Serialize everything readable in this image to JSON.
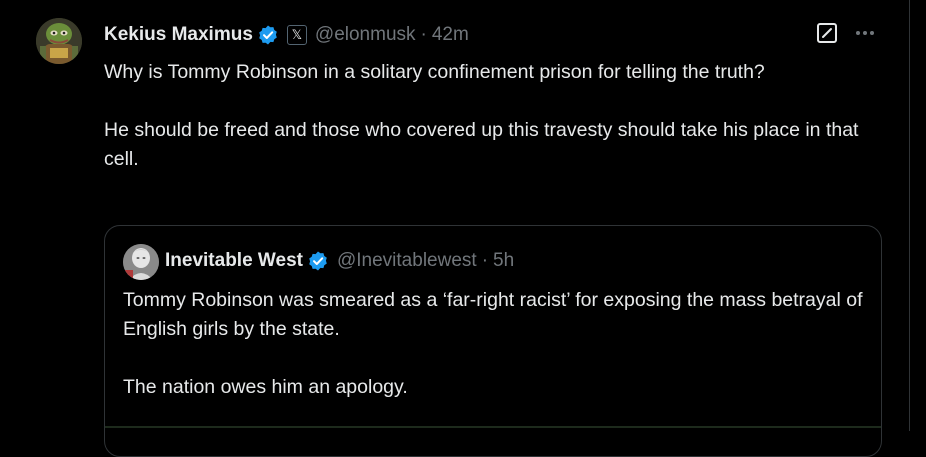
{
  "tweet": {
    "author_name": "Kekius Maximus",
    "handle": "@elonmusk",
    "separator": "·",
    "time": "42m",
    "paragraphs": [
      "Why is Tommy Robinson in a solitary confinement prison for telling the truth?",
      "He should be freed and those who covered up this travesty should take his place in that cell."
    ]
  },
  "quote": {
    "author_name": "Inevitable West",
    "handle": "@Inevitablewest",
    "separator": "·",
    "time": "5h",
    "paragraphs": [
      "Tommy Robinson was smeared as a ‘far-right racist’ for exposing the mass betrayal of English girls by the state.",
      "The nation owes him an apology."
    ]
  },
  "icons": {
    "verified_color": "#1d9bf0",
    "badge": "x-logo-icon",
    "grok": "grok-icon",
    "more": "more-icon"
  },
  "colors": {
    "background": "#000000",
    "text": "#e7e9ea",
    "muted": "#71767b",
    "border": "#2f3336"
  }
}
